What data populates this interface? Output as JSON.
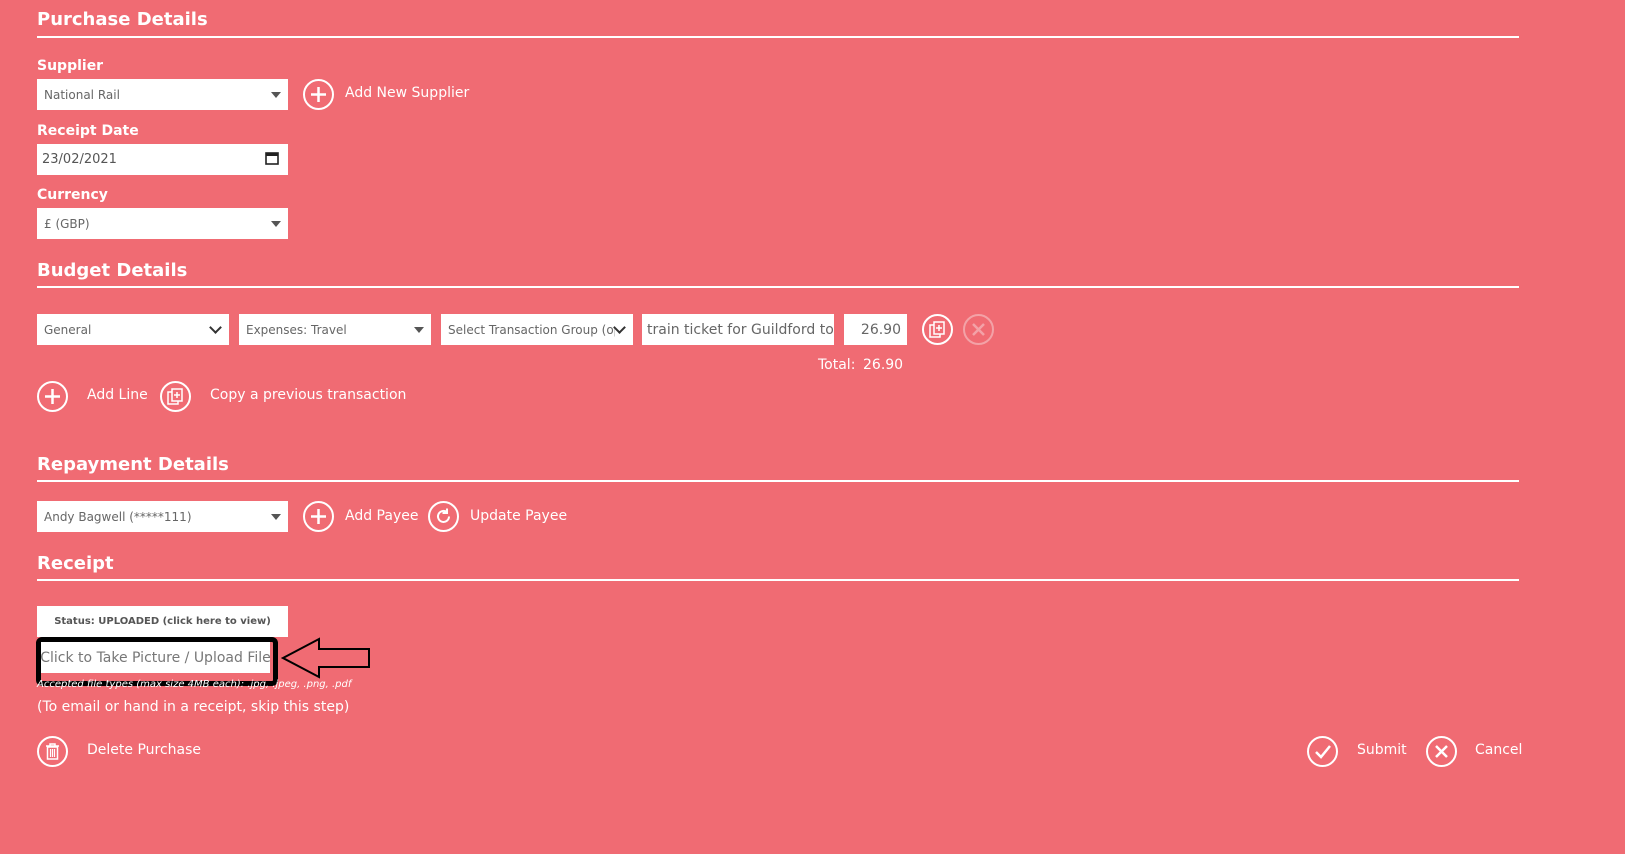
{
  "purchase": {
    "title": "Purchase Details",
    "supplier_label": "Supplier",
    "supplier_value": "National Rail",
    "add_supplier": "Add New Supplier",
    "receipt_date_label": "Receipt Date",
    "receipt_date_value": "23/02/2021",
    "currency_label": "Currency",
    "currency_value": "£ (GBP)"
  },
  "budget": {
    "title": "Budget Details",
    "line": {
      "budget": "General",
      "category": "Expenses: Travel",
      "transaction_group": "Select Transaction Group (op",
      "description": "train ticket for Guildford to L",
      "amount": "26.90"
    },
    "total_label": "Total:",
    "total_value": "26.90",
    "add_line": "Add Line",
    "copy_previous": "Copy a previous transaction"
  },
  "repayment": {
    "title": "Repayment Details",
    "payee_value": "Andy Bagwell (*****111)",
    "add_payee": "Add Payee",
    "update_payee": "Update Payee"
  },
  "receipt": {
    "title": "Receipt",
    "status_button": "Status: UPLOADED (click here to view)",
    "upload_button": "Click to Take Picture / Upload File",
    "accepted_types": "Accepted file types (max size 4MB each): .jpg, .jpeg, .png, .pdf",
    "skip_note": "(To email or hand in a receipt, skip this step)"
  },
  "actions": {
    "delete": "Delete Purchase",
    "submit": "Submit",
    "cancel": "Cancel"
  },
  "colors": {
    "background": "#f06b73",
    "highlight_border": "#000000"
  },
  "icons": [
    "plus-circle-icon",
    "calendar-icon",
    "copy-icon",
    "close-icon",
    "refresh-icon",
    "trash-icon",
    "check-icon",
    "arrow-left-icon"
  ]
}
